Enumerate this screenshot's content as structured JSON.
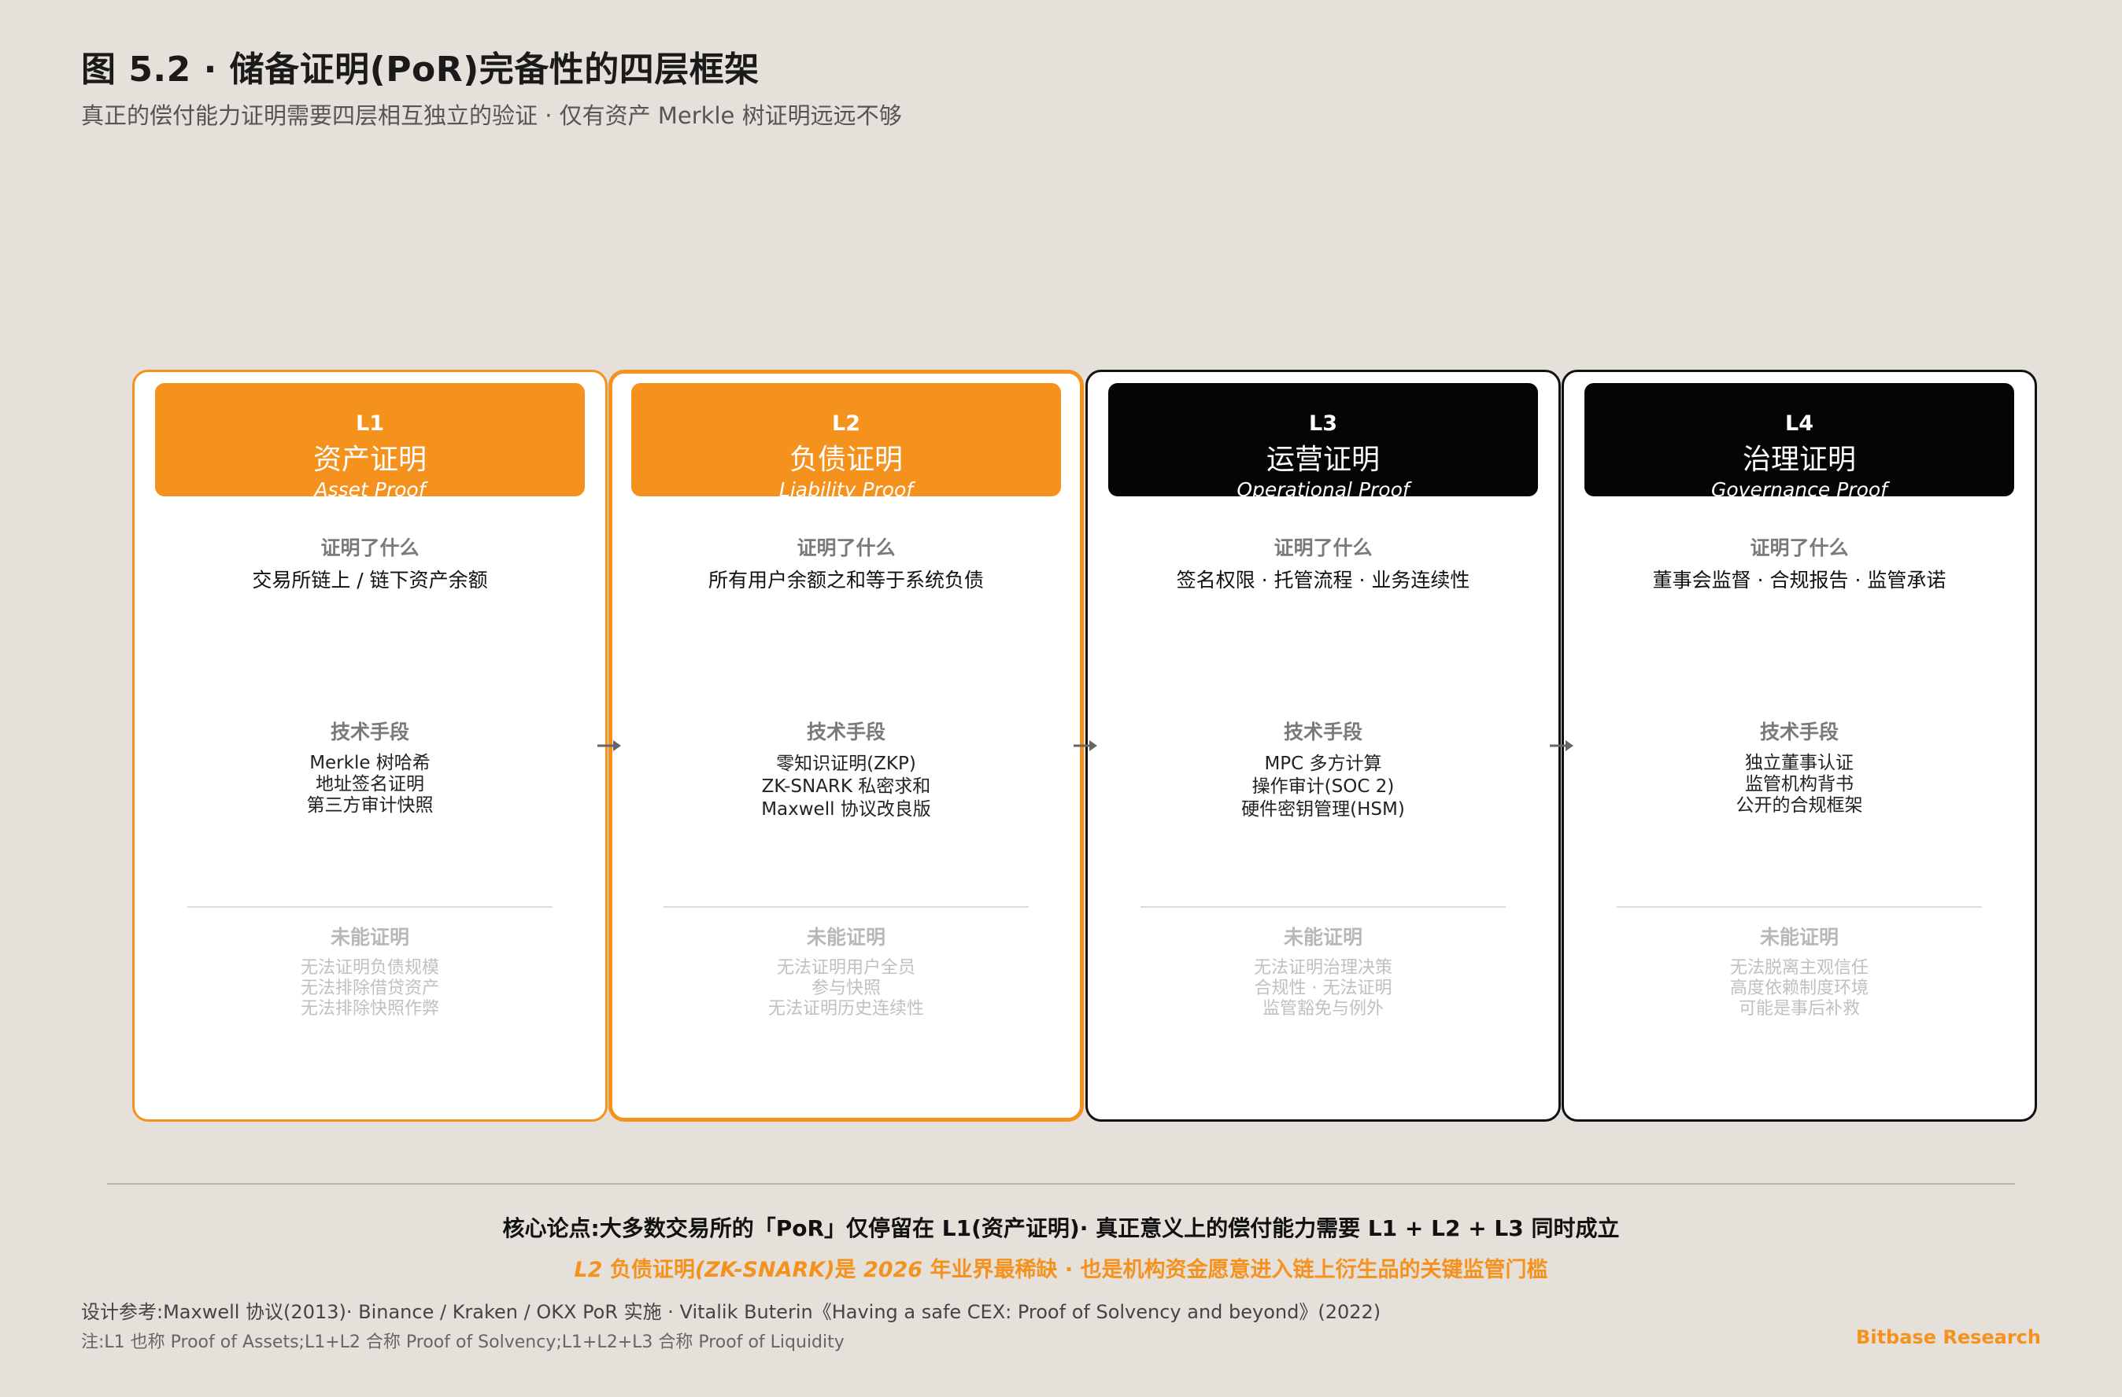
{
  "header": {
    "title": "图 5.2 · 储备证明(PoR)完备性的四层框架",
    "subtitle": "真正的偿付能力证明需要四层相互独立的验证 · 仅有资产 Merkle 树证明远远不够"
  },
  "section_labels": {
    "proves": "证明了什么",
    "tech": "技术手段",
    "cannot": "未能证明"
  },
  "layers": [
    {
      "level": "L1",
      "name": "资产证明",
      "name_en": "Asset Proof",
      "proves": "交易所链上 / 链下资产余额",
      "tech": [
        "Merkle 树哈希",
        "地址签名证明",
        "第三方审计快照"
      ],
      "cannot": [
        "无法证明负债规模",
        "无法排除借贷资产",
        "无法排除快照作弊"
      ]
    },
    {
      "level": "L2",
      "name": "负债证明",
      "name_en": "Liability Proof",
      "proves": "所有用户余额之和等于系统负债",
      "tech": [
        "零知识证明(ZKP)",
        "ZK-SNARK 私密求和",
        "Maxwell 协议改良版"
      ],
      "cannot": [
        "无法证明用户全员",
        "参与快照",
        "无法证明历史连续性"
      ]
    },
    {
      "level": "L3",
      "name": "运营证明",
      "name_en": "Operational Proof",
      "proves": "签名权限 · 托管流程 · 业务连续性",
      "tech": [
        "MPC 多方计算",
        "操作审计(SOC 2)",
        "硬件密钥管理(HSM)"
      ],
      "cannot": [
        "无法证明治理决策",
        "合规性 · 无法证明",
        "监管豁免与例外"
      ]
    },
    {
      "level": "L4",
      "name": "治理证明",
      "name_en": "Governance Proof",
      "proves": "董事会监督 · 合规报告 · 监管承诺",
      "tech": [
        "独立董事认证",
        "监管机构背书",
        "公开的合规框架"
      ],
      "cannot": [
        "无法脱离主观信任",
        "高度依赖制度环境",
        "可能是事后补救"
      ]
    }
  ],
  "footer": {
    "thesis": "核心论点:大多数交易所的「PoR」仅停留在 L1(资产证明)· 真正意义上的偿付能力需要 L1 + L2 + L3 同时成立",
    "highlight_parts": [
      "L2",
      " 负债证明",
      "(ZK-SNARK)",
      "是 ",
      "2026",
      " 年业界最稀缺 · 也是机构资金愿意进入链上衍生品的关键监管门槛"
    ],
    "reference": "设计参考:Maxwell 协议(2013)· Binance / Kraken / OKX PoR 实施 · Vitalik Buterin《Having a safe CEX: Proof of Solvency and beyond》(2022)",
    "note": "注:L1 也称 Proof of Assets;L1+L2 合称 Proof of Solvency;L1+L2+L3 合称 Proof of Liquidity",
    "brand": "Bitbase Research"
  },
  "colors": {
    "accent": "#f5921e",
    "dark": "#050505",
    "background": "#e5e0da"
  }
}
